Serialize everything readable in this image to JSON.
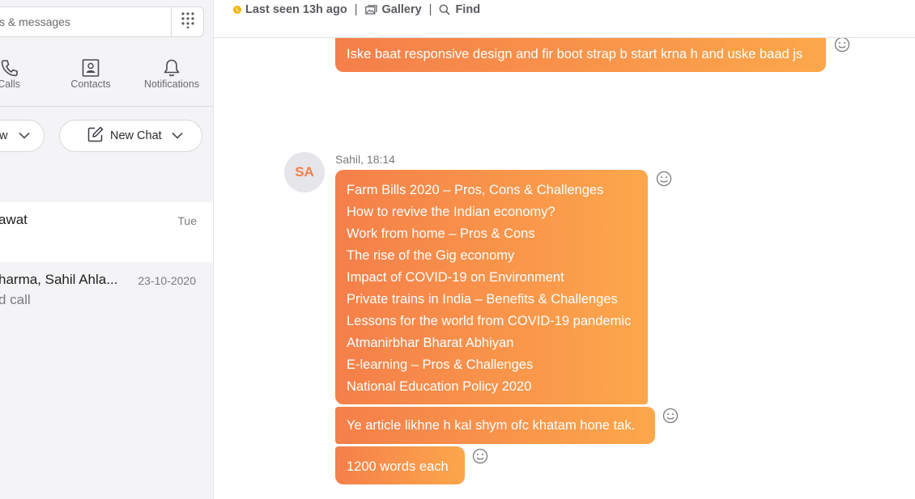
{
  "sidebar": {
    "search": {
      "placeholder": "s & messages"
    },
    "tabs": [
      {
        "label": "Calls",
        "icon": "phone-icon"
      },
      {
        "label": "Contacts",
        "icon": "contacts-icon"
      },
      {
        "label": "Notifications",
        "icon": "bell-icon"
      }
    ],
    "left_pill_label": "w",
    "new_chat_label": "New Chat",
    "chats": [
      {
        "name": "awat",
        "date": "Tue",
        "subtitle": ""
      },
      {
        "name": "harma, Sahil Ahla...",
        "date": "23-10-2020",
        "subtitle": "d call"
      }
    ]
  },
  "header": {
    "status_text": "Last seen 13h ago",
    "separator": "|",
    "gallery_label": "Gallery",
    "find_label": "Find",
    "status_color": "#f5b400"
  },
  "messages": {
    "top_bubble": "Iske baat responsive design and fir boot strap b start krna h and uske baad js",
    "sender_initials": "SA",
    "sender_line": "Sahil, 18:14",
    "topic_list": [
      "Farm Bills 2020 – Pros, Cons & Challenges",
      "How to revive the Indian economy?",
      "Work from home – Pros & Cons",
      "The rise of the Gig economy",
      "Impact of COVID-19 on Environment",
      "Private trains in India – Benefits & Challenges",
      "Lessons for the world from COVID-19 pandemic",
      "Atmanirbhar Bharat Abhiyan",
      "E-learning – Pros & Challenges",
      "National Education Policy 2020"
    ],
    "followup": "Ye article likhne h kal shym ofc khatam hone tak.",
    "last": "1200 words each"
  },
  "colors": {
    "bubble_start": "#f57f4a",
    "bubble_end": "#fca74b",
    "avatar_text": "#f27f49"
  }
}
